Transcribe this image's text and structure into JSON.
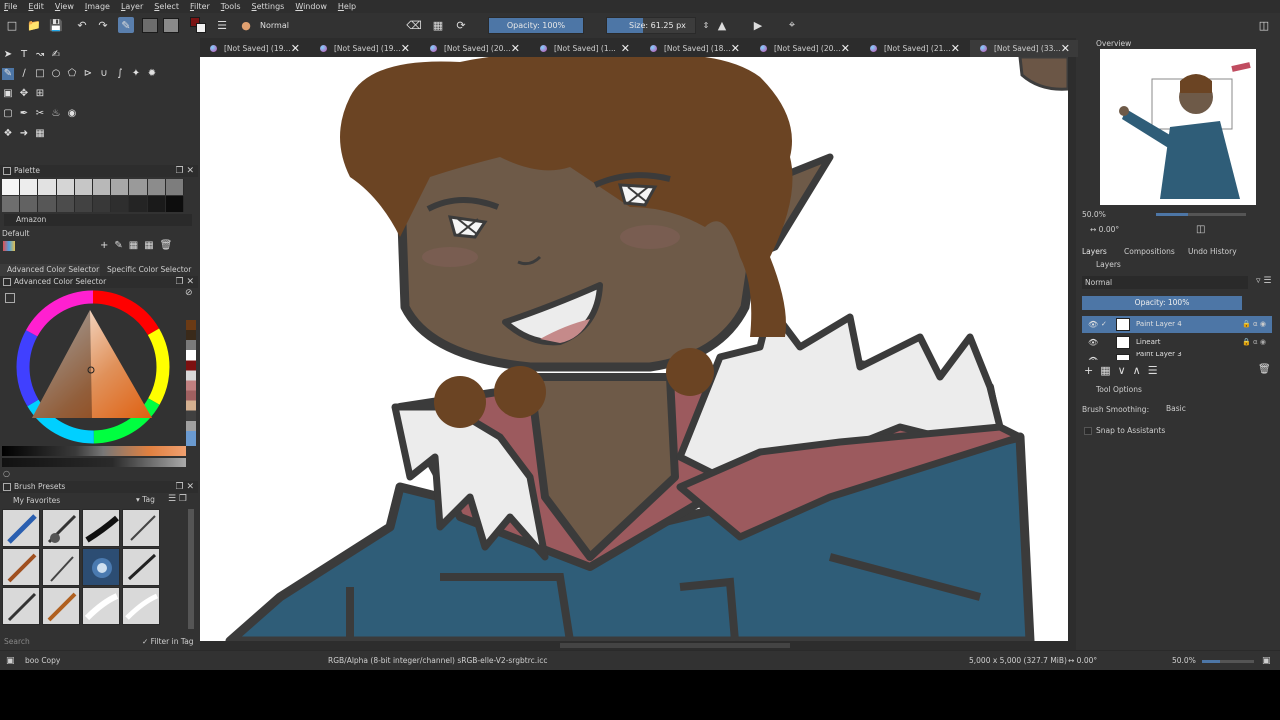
{
  "menu": [
    "File",
    "Edit",
    "View",
    "Image",
    "Layer",
    "Select",
    "Filter",
    "Tools",
    "Settings",
    "Window",
    "Help"
  ],
  "toolbar": {
    "blend_mode": "Normal",
    "opacity_label": "Opacity: 100%",
    "opacity_value": 1.0,
    "size_label": "Size: 61.25 px"
  },
  "tabs": [
    "[Not Saved] (19...",
    "[Not Saved] (19...",
    "[Not Saved] (20...",
    "[Not Saved] (1...",
    "[Not Saved] (18...",
    "[Not Saved] (20...",
    "[Not Saved] (21...",
    "[Not Saved] (33..."
  ],
  "active_tab_index": 7,
  "palette": {
    "title": "Palette",
    "palette_name": "Amazon",
    "group_name": "Default"
  },
  "color_selector": {
    "tab_advanced": "Advanced Color Selector",
    "tab_specific": "Specific Color Selector",
    "panel_title": "Advanced Color Selector"
  },
  "brush_presets": {
    "title": "Brush Presets",
    "favorites": "My Favorites",
    "tag_label": "Tag",
    "search_placeholder": "Search",
    "filter_label": "Filter in Tag"
  },
  "overview": {
    "title": "Overview",
    "zoom": "50.0%",
    "rotation": "0.00°"
  },
  "docker_tabs": [
    "Layers",
    "Compositions",
    "Undo History"
  ],
  "layers": {
    "title": "Layers",
    "blend_mode": "Normal",
    "opacity_label": "Opacity:  100%",
    "items": [
      {
        "name": "Paint Layer 4",
        "selected": true
      },
      {
        "name": "Lineart",
        "selected": false
      },
      {
        "name": "Paint Layer 3",
        "selected": false
      }
    ]
  },
  "tool_options": {
    "title": "Tool Options",
    "smoothing_label": "Brush Smoothing:",
    "smoothing_value": "Basic",
    "snap_label": "Snap to Assistants"
  },
  "status": {
    "brush": "boo Copy",
    "color_space": "RGB/Alpha (8-bit integer/channel)  sRGB-elle-V2-srgbtrc.icc",
    "dimensions": "5,000 x 5,000 (327.7 MiB)",
    "rotation": "0.00°",
    "zoom": "50.0%"
  },
  "colors": {
    "accent": "#4d76a6",
    "skin": "#6e5a48",
    "hair": "#6b4423",
    "jacket": "#2f5d78",
    "shirt": "#9c5a5e"
  }
}
